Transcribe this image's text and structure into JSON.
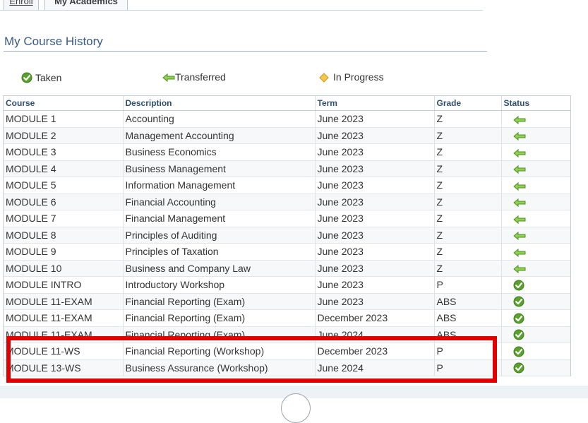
{
  "tabs": {
    "enroll": "Enroll",
    "academics": "My Academics"
  },
  "page": {
    "title": "My Course History"
  },
  "legend": [
    {
      "icon": "check-icon",
      "label": "Taken"
    },
    {
      "icon": "arrow-left-icon",
      "label": "Transferred"
    },
    {
      "icon": "diamond-icon",
      "label": "In Progress"
    }
  ],
  "table": {
    "headers": {
      "course": "Course",
      "description": "Description",
      "term": "Term",
      "grade": "Grade",
      "status": "Status"
    },
    "rows": [
      {
        "course": "MODULE 1",
        "description": "Accounting",
        "term": "June 2023",
        "grade": "Z",
        "status": "transferred"
      },
      {
        "course": "MODULE 2",
        "description": "Management Accounting",
        "term": "June 2023",
        "grade": "Z",
        "status": "transferred"
      },
      {
        "course": "MODULE 3",
        "description": "Business Economics",
        "term": "June 2023",
        "grade": "Z",
        "status": "transferred"
      },
      {
        "course": "MODULE 4",
        "description": "Business Management",
        "term": "June 2023",
        "grade": "Z",
        "status": "transferred"
      },
      {
        "course": "MODULE 5",
        "description": "Information Management",
        "term": "June 2023",
        "grade": "Z",
        "status": "transferred"
      },
      {
        "course": "MODULE 6",
        "description": "Financial Accounting",
        "term": "June 2023",
        "grade": "Z",
        "status": "transferred"
      },
      {
        "course": "MODULE 7",
        "description": "Financial Management",
        "term": "June 2023",
        "grade": "Z",
        "status": "transferred"
      },
      {
        "course": "MODULE 8",
        "description": "Principles of Auditing",
        "term": "June 2023",
        "grade": "Z",
        "status": "transferred"
      },
      {
        "course": "MODULE 9",
        "description": "Principles of Taxation",
        "term": "June 2023",
        "grade": "Z",
        "status": "transferred"
      },
      {
        "course": "MODULE 10",
        "description": "Business and Company Law",
        "term": "June 2023",
        "grade": "Z",
        "status": "transferred"
      },
      {
        "course": "MODULE INTRO",
        "description": "Introductory Workshop",
        "term": "June 2023",
        "grade": "P",
        "status": "taken"
      },
      {
        "course": "MODULE 11-EXAM",
        "description": "Financial Reporting (Exam)",
        "term": "June 2023",
        "grade": "ABS",
        "status": "taken"
      },
      {
        "course": "MODULE 11-EXAM",
        "description": "Financial Reporting (Exam)",
        "term": "December 2023",
        "grade": "ABS",
        "status": "taken"
      },
      {
        "course": "MODULE 11-EXAM",
        "description": "Financial Reporting (Exam)",
        "term": "June 2024",
        "grade": "ABS",
        "status": "taken"
      },
      {
        "course": "MODULE 11-WS",
        "description": "Financial Reporting (Workshop)",
        "term": "December 2023",
        "grade": "P",
        "status": "taken"
      },
      {
        "course": "MODULE 13-WS",
        "description": "Business Assurance (Workshop)",
        "term": "June 2024",
        "grade": "P",
        "status": "taken"
      }
    ]
  },
  "colors": {
    "accent": "#3b5c84",
    "highlight": "#e00000",
    "transferred": "#7cc242",
    "taken": "#5aa02c",
    "in_progress": "#f0c040"
  }
}
